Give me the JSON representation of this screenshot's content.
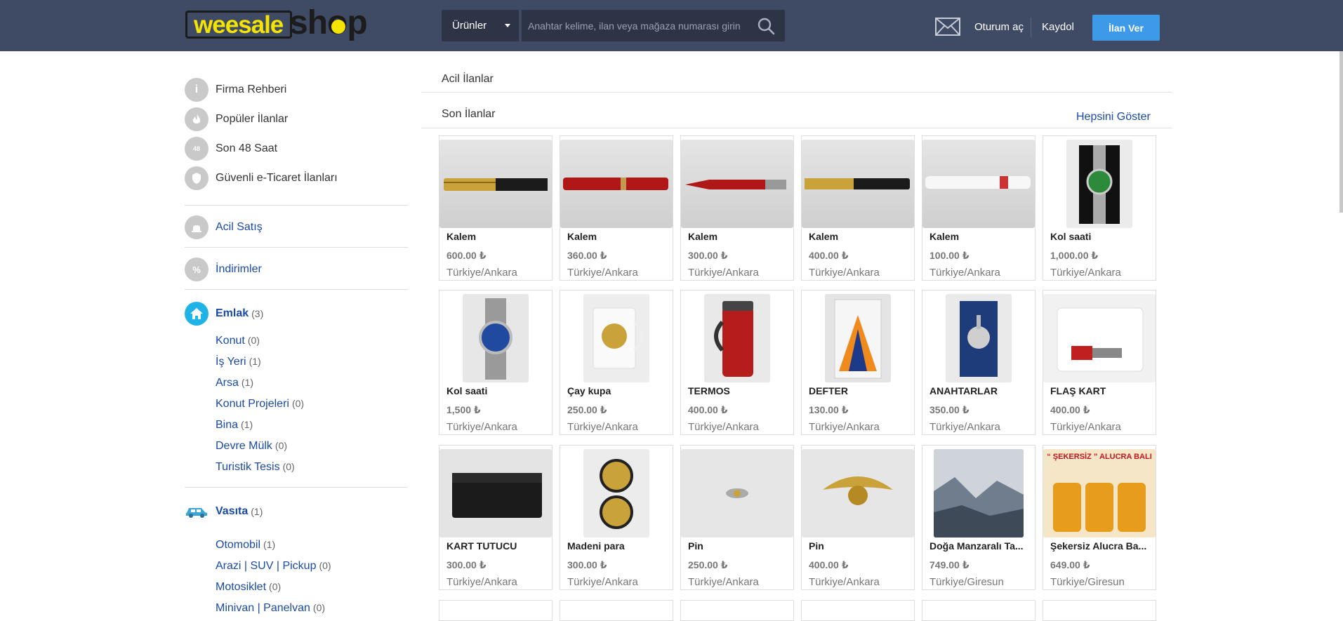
{
  "header": {
    "logo_part1": "weesale",
    "logo_part2": "shop",
    "category": "Ürünler",
    "search_placeholder": "Anahtar kelime, ilan veya mağaza numarası girin",
    "login": "Oturum aç",
    "register": "Kaydol",
    "post_ad": "İlan Ver"
  },
  "sidebar": {
    "links": [
      {
        "label": "Firma Rehberi",
        "icon": "info-icon"
      },
      {
        "label": "Popüler İlanlar",
        "icon": "fire-icon"
      },
      {
        "label": "Son 48 Saat",
        "icon": "clock-48-icon"
      },
      {
        "label": "Güvenli e-Ticaret İlanları",
        "icon": "secure-shield-icon"
      }
    ],
    "urgent": "Acil Satış",
    "discounts": "İndirimler",
    "emlak": {
      "title": "Emlak",
      "count": "(3)",
      "items": [
        {
          "label": "Konut",
          "count": "(0)"
        },
        {
          "label": "İş Yeri",
          "count": "(1)"
        },
        {
          "label": "Arsa",
          "count": "(1)"
        },
        {
          "label": "Konut Projeleri",
          "count": "(0)"
        },
        {
          "label": "Bina",
          "count": "(1)"
        },
        {
          "label": "Devre Mülk",
          "count": "(0)"
        },
        {
          "label": "Turistik Tesis",
          "count": "(0)"
        }
      ]
    },
    "vasita": {
      "title": "Vasıta",
      "count": "(1)",
      "items": [
        {
          "label": "Otomobil",
          "count": "(1)"
        },
        {
          "label": "Arazi | SUV | Pickup",
          "count": "(0)"
        },
        {
          "label": "Motosiklet",
          "count": "(0)"
        },
        {
          "label": "Minivan | Panelvan",
          "count": "(0)"
        }
      ]
    }
  },
  "main": {
    "urgent_title": "Acil İlanlar",
    "latest_title": "Son İlanlar",
    "show_all": "Hepsini Göster",
    "listings": [
      {
        "title": "Kalem",
        "price": "600.00 ₺",
        "location": "Türkiye/Ankara",
        "img": "pen-gold"
      },
      {
        "title": "Kalem",
        "price": "360.00 ₺",
        "location": "Türkiye/Ankara",
        "img": "pen-red"
      },
      {
        "title": "Kalem",
        "price": "300.00 ₺",
        "location": "Türkiye/Ankara",
        "img": "pen-red2"
      },
      {
        "title": "Kalem",
        "price": "400.00 ₺",
        "location": "Türkiye/Ankara",
        "img": "pen-gold2"
      },
      {
        "title": "Kalem",
        "price": "100.00 ₺",
        "location": "Türkiye/Ankara",
        "img": "pen-white"
      },
      {
        "title": "Kol saati",
        "price": "1,000.00 ₺",
        "location": "Türkiye/Ankara",
        "img": "watch-green"
      },
      {
        "title": "Kol saati",
        "price": "1,500 ₺",
        "location": "Türkiye/Ankara",
        "img": "watch-blue"
      },
      {
        "title": "Çay kupa",
        "price": "250.00 ₺",
        "location": "Türkiye/Ankara",
        "img": "mug"
      },
      {
        "title": "TERMOS",
        "price": "400.00 ₺",
        "location": "Türkiye/Ankara",
        "img": "thermos"
      },
      {
        "title": "DEFTER",
        "price": "130.00 ₺",
        "location": "Türkiye/Ankara",
        "img": "notebook"
      },
      {
        "title": "ANAHTARLAR",
        "price": "350.00 ₺",
        "location": "Türkiye/Ankara",
        "img": "keychain"
      },
      {
        "title": "FLAŞ KART",
        "price": "400.00 ₺",
        "location": "Türkiye/Ankara",
        "img": "usb"
      },
      {
        "title": "KART TUTUCU",
        "price": "300.00 ₺",
        "location": "Türkiye/Ankara",
        "img": "card-holder"
      },
      {
        "title": "Madeni para",
        "price": "300.00 ₺",
        "location": "Türkiye/Ankara",
        "img": "coins"
      },
      {
        "title": "Pin",
        "price": "250.00 ₺",
        "location": "Türkiye/Ankara",
        "img": "pin-silver"
      },
      {
        "title": "Pin",
        "price": "400.00 ₺",
        "location": "Türkiye/Ankara",
        "img": "pin-gold"
      },
      {
        "title": "Doğa Manzaralı Ta...",
        "price": "749.00 ₺",
        "location": "Türkiye/Giresun",
        "img": "landscape"
      },
      {
        "title": "Şekersiz Alucra Ba...",
        "price": "649.00 ₺",
        "location": "Türkiye/Giresun",
        "img": "honey",
        "banner": "“ ŞEKERSİZ ” ALUCRA BALI"
      }
    ]
  }
}
